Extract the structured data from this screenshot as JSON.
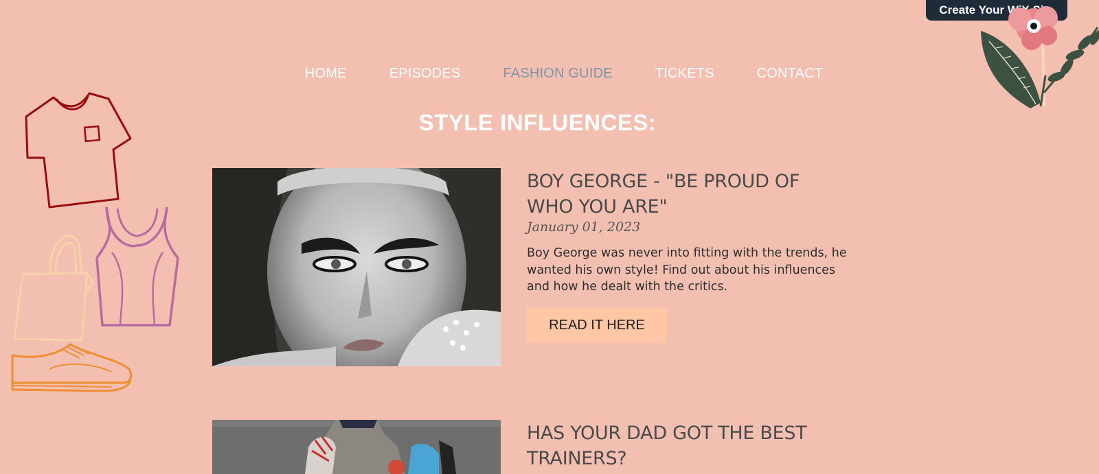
{
  "banner": {
    "label": "Create Your WiX Site"
  },
  "nav": {
    "items": [
      {
        "label": "HOME",
        "active": false
      },
      {
        "label": "EPISODES",
        "active": false
      },
      {
        "label": "FASHION GUIDE",
        "active": true
      },
      {
        "label": "TICKETS",
        "active": false
      },
      {
        "label": "CONTACT",
        "active": false
      }
    ]
  },
  "page": {
    "title": "STYLE INFLUENCES:"
  },
  "posts": [
    {
      "title": "BOY GEORGE - \"BE PROUD OF WHO YOU ARE\"",
      "date": "January 01, 2023",
      "excerpt": "Boy George was never into fitting with the trends, he wanted his own style! Find out about his influences and how he dealt with the critics.",
      "button_label": "READ IT HERE"
    },
    {
      "title": "HAS YOUR DAD GOT THE BEST TRAINERS?"
    }
  ],
  "icons": {
    "decorations": [
      "tshirt-icon",
      "tote-bag-icon",
      "tank-top-icon",
      "shoe-icon",
      "flower-icon"
    ]
  },
  "colors": {
    "background": "#F2BFB1",
    "nav_active": "#7D95A5",
    "button": "#FFC7A5",
    "banner": "#1E2B38",
    "title_text": "#4A4A4A"
  }
}
